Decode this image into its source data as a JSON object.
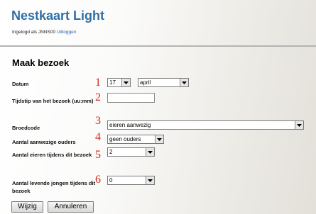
{
  "header": {
    "title": "Nestkaart Light",
    "login_prefix": "Ingelogd als JNNS00",
    "logout_link": "Uitloggen"
  },
  "form": {
    "title": "Maak bezoek",
    "rows": [
      {
        "label": "Datum",
        "number": "1"
      },
      {
        "label": "Tijdstip van het bezoek (uu:mm)",
        "number": "2"
      },
      {
        "label": "Broedcode",
        "number": "3"
      },
      {
        "label": "Aantal aanwezige ouders",
        "number": "4"
      },
      {
        "label": "Aantal eieren tijdens dit bezoek",
        "number": "5"
      },
      {
        "label": "Aantal levende jongen tijdens dit bezoek",
        "number": "6"
      }
    ],
    "date_day": "17",
    "date_month": "april",
    "time_value": "",
    "breedcode": "eieren aanwezig",
    "parents": "geen ouders",
    "eggs": "2",
    "young": "0"
  },
  "buttons": {
    "save": "Wijzig",
    "cancel": "Annuleren"
  },
  "colors": {
    "title": "#2f6fa6",
    "annotation_numbers": "#d8231c"
  }
}
